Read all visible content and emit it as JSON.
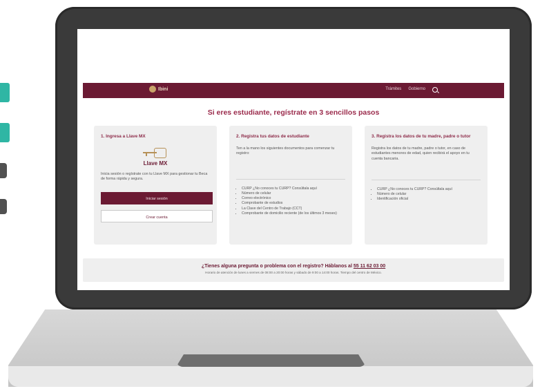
{
  "header": {
    "logo_text": "Ibini",
    "nav": [
      "Trámites",
      "Gobierno"
    ]
  },
  "title": "Si eres estudiante, regístrate en 3 sencillos pasos",
  "cards": [
    {
      "title": "1. Ingresa a Llave MX",
      "llave_label": "Llave MX",
      "text": "Inicia sesión o regístrate con tu Llave MX para gestionar tu Beca de forma rápida y segura.",
      "primary_button": "Iniciar sesión",
      "secondary_button": "Crear cuenta"
    },
    {
      "title": "2. Registra tus datos de estudiante",
      "text": "Ten a la mano los siguientes documentos para comenzar tu registro:",
      "items": [
        "CURP ¿No conoces tu CURP? Consúltala aquí",
        "Número de celular",
        "Correo electrónico",
        "Comprobante de estudios",
        "La Clave del Centro de Trabajo (CCT)",
        "Comprobante de domicilio reciente (de los últimos 3 meses)"
      ]
    },
    {
      "title": "3. Registra los datos de tu madre, padre o tutor",
      "text": "Registra los datos de tu madre, padre o tutor, en caso de estudiantes menores de edad, quien recibirá el apoyo en tu cuenta bancaria.",
      "items": [
        "CURP ¿No conoces tu CURP? Consúltala aquí",
        "Número de celular",
        "Identificación oficial"
      ],
      "link_text": "Consúltala aquí"
    }
  ],
  "help": {
    "question": "¿Tienes alguna pregunta o problema con el registro? Háblanos al",
    "phone": "55 11 62 03 00",
    "hours": "Horario de atención de lunes a viernes de 08:00 a 20:00 horas y sábado de 9:00 a 14:00 horas. Tiempo del centro de México."
  },
  "colors": {
    "brand": "#6b1a33",
    "accent_text": "#9a2a4b",
    "teal": "#2fb6a4"
  }
}
